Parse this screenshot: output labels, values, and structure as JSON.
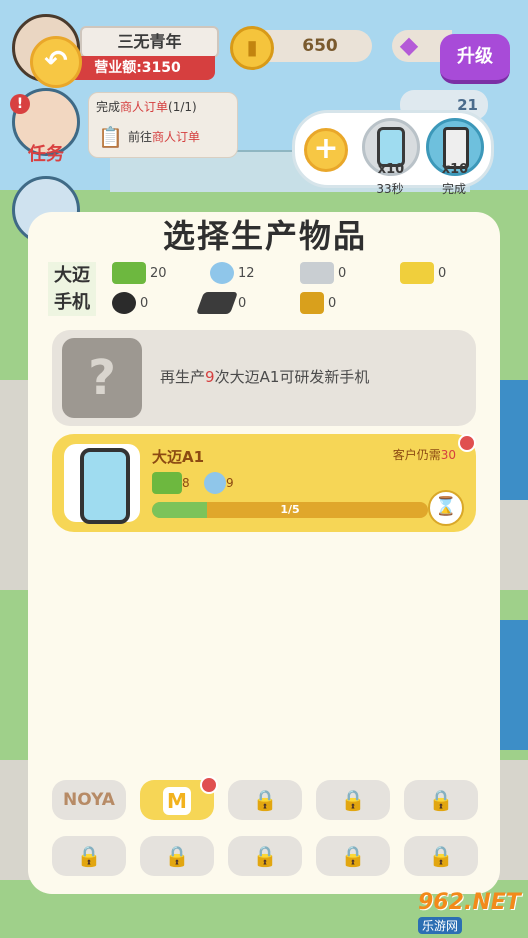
{
  "hud": {
    "player_name": "三无青年",
    "revenue": "营业额:3150",
    "coins": "650",
    "staff": "21",
    "upgrade_label": "升级"
  },
  "task": {
    "label": "任务",
    "alert": "!",
    "line1_prefix": "完成",
    "line1_highlight": "商人订单",
    "line1_suffix": "(1/1)",
    "line2_prefix": "前往",
    "line2_highlight": "商人订单"
  },
  "queue": {
    "add_label": "+",
    "slots": [
      {
        "count": "x10",
        "status": "33秒"
      },
      {
        "count": "x10",
        "status": "完成"
      }
    ]
  },
  "panel": {
    "title": "选择生产物品",
    "brand_label_line1": "大迈",
    "brand_label_line2": "手机",
    "materials_row1": [
      {
        "icon": "circuit-board-icon",
        "count": "20",
        "color": "#6db83f"
      },
      {
        "icon": "worker-icon",
        "count": "12",
        "color": "#8fc6ea"
      },
      {
        "icon": "chip-module-icon",
        "count": "0",
        "color": "#c9ced2"
      },
      {
        "icon": "antenna-icon",
        "count": "0",
        "color": "#f0cf3c"
      }
    ],
    "materials_row2": [
      {
        "icon": "camera-lens-icon",
        "count": "0",
        "color": "#2b2b2b"
      },
      {
        "icon": "screen-panel-icon",
        "count": "0",
        "color": "#3b3b3b"
      },
      {
        "icon": "processor-chip-icon",
        "count": "0",
        "color": "#d9a01c"
      }
    ],
    "research": {
      "prefix": "再生产",
      "number": "9",
      "suffix": "次大迈A1可研发新手机",
      "icon_text": "?"
    },
    "product": {
      "name": "大迈A1",
      "demand_prefix": "客户仍需",
      "demand_number": "30",
      "requirements": [
        {
          "icon": "circuit-board-icon",
          "count": "8",
          "color": "#6db83f"
        },
        {
          "icon": "worker-icon",
          "count": "9",
          "color": "#8fc6ea"
        }
      ],
      "progress_text": "1/5",
      "progress_value": 0.2
    },
    "tabs": [
      {
        "label": "NOYA",
        "locked": false,
        "active": false
      },
      {
        "label": "M",
        "locked": false,
        "active": true,
        "badge": true
      },
      {
        "label": "",
        "locked": true
      },
      {
        "label": "",
        "locked": true
      },
      {
        "label": "",
        "locked": true
      },
      {
        "label": "",
        "locked": true
      },
      {
        "label": "",
        "locked": true
      },
      {
        "label": "",
        "locked": true
      },
      {
        "label": "",
        "locked": true
      },
      {
        "label": "",
        "locked": true
      }
    ]
  },
  "watermark": {
    "main": "962.NET",
    "sub": "乐游网"
  }
}
